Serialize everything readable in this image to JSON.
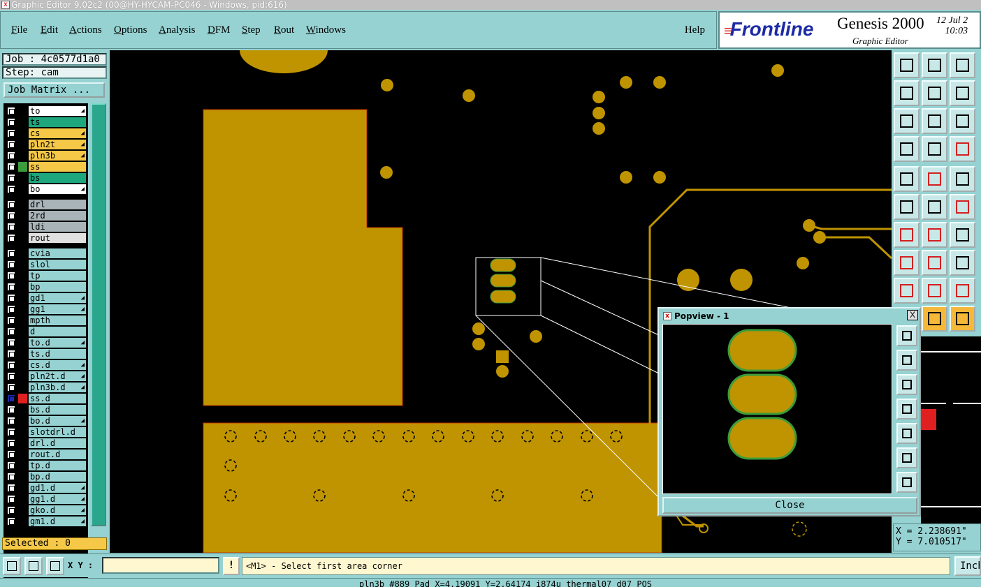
{
  "window": {
    "title": "Graphic Editor 9.02c2 (00@HY-HYCAM-PC046 - Windows, pid:616)"
  },
  "menu": {
    "items": [
      "File",
      "Edit",
      "Actions",
      "Options",
      "Analysis",
      "DFM",
      "Step",
      "Rout",
      "Windows"
    ],
    "help": "Help"
  },
  "logo": {
    "brand": "Frontline",
    "product": "Genesis 2000",
    "subtitle": "Graphic Editor",
    "date": "12 Jul 2",
    "time": "10:03"
  },
  "job": {
    "job_label": "Job : 4c0577d1a0",
    "step_label": "Step: cam",
    "matrix_button": "Job Matrix ..."
  },
  "layers": [
    {
      "name": "to",
      "color": "#ffffff",
      "arrow": true
    },
    {
      "name": "ts",
      "color": "#1ea67c",
      "arrow": false
    },
    {
      "name": "cs",
      "color": "#f5c847",
      "arrow": true
    },
    {
      "name": "pln2t",
      "color": "#f5c847",
      "arrow": true
    },
    {
      "name": "pln3b",
      "color": "#f5c847",
      "arrow": true
    },
    {
      "name": "ss",
      "color": "#f5c847",
      "arrow": false,
      "swatch": "#3c9c3c"
    },
    {
      "name": "bs",
      "color": "#1ea67c",
      "arrow": false
    },
    {
      "name": "bo",
      "color": "#ffffff",
      "arrow": true
    },
    {
      "name": "drl",
      "color": "#a8b4b8",
      "arrow": false
    },
    {
      "name": "2rd",
      "color": "#a8b4b8",
      "arrow": false
    },
    {
      "name": "ldi",
      "color": "#a8b4b8",
      "arrow": false
    },
    {
      "name": "rout",
      "color": "#e0e0e0",
      "arrow": false
    },
    {
      "name": "cvia",
      "color": "#96d2d2",
      "arrow": false
    },
    {
      "name": "slol",
      "color": "#96d2d2",
      "arrow": false
    },
    {
      "name": "tp",
      "color": "#96d2d2",
      "arrow": false
    },
    {
      "name": "bp",
      "color": "#96d2d2",
      "arrow": false
    },
    {
      "name": "gd1",
      "color": "#96d2d2",
      "arrow": true
    },
    {
      "name": "gg1",
      "color": "#96d2d2",
      "arrow": true
    },
    {
      "name": "mpth",
      "color": "#96d2d2",
      "arrow": false
    },
    {
      "name": "d",
      "color": "#96d2d2",
      "arrow": false
    },
    {
      "name": "to.d",
      "color": "#96d2d2",
      "arrow": true
    },
    {
      "name": "ts.d",
      "color": "#96d2d2",
      "arrow": false
    },
    {
      "name": "cs.d",
      "color": "#96d2d2",
      "arrow": true
    },
    {
      "name": "pln2t.d",
      "color": "#96d2d2",
      "arrow": true
    },
    {
      "name": "pln3b.d",
      "color": "#96d2d2",
      "arrow": true
    },
    {
      "name": "ss.d",
      "color": "#96d2d2",
      "arrow": false,
      "swatch": "#e02020",
      "active": true
    },
    {
      "name": "bs.d",
      "color": "#96d2d2",
      "arrow": false
    },
    {
      "name": "bo.d",
      "color": "#96d2d2",
      "arrow": true
    },
    {
      "name": "slotdrl.d",
      "color": "#96d2d2",
      "arrow": false
    },
    {
      "name": "drl.d",
      "color": "#96d2d2",
      "arrow": false
    },
    {
      "name": "rout.d",
      "color": "#96d2d2",
      "arrow": false
    },
    {
      "name": "tp.d",
      "color": "#96d2d2",
      "arrow": false
    },
    {
      "name": "bp.d",
      "color": "#96d2d2",
      "arrow": false
    },
    {
      "name": "gd1.d",
      "color": "#96d2d2",
      "arrow": true
    },
    {
      "name": "gg1.d",
      "color": "#96d2d2",
      "arrow": true
    },
    {
      "name": "gko.d",
      "color": "#96d2d2",
      "arrow": true
    },
    {
      "name": "gm1.d",
      "color": "#96d2d2",
      "arrow": true
    }
  ],
  "selected_label": "Selected : 0",
  "popview": {
    "title": "Popview - 1",
    "close_label": "Close",
    "close_x": "X"
  },
  "coords": {
    "x": "X = 2.238691\"",
    "y": "Y = 7.010517\""
  },
  "bottom": {
    "xy_label": "X Y :",
    "xy_value": "",
    "warn": "!",
    "prompt": "<M1> - Select first area corner",
    "unit": "Inch"
  },
  "statusline": "pln3b #889 Pad X=4.19091 Y=2.64174 i874u thermal07 d07 POS",
  "colors": {
    "copper": "#bf9400",
    "canvas": "#000000",
    "panel": "#96d2d2",
    "pad_edge": "#3c9c3c"
  }
}
